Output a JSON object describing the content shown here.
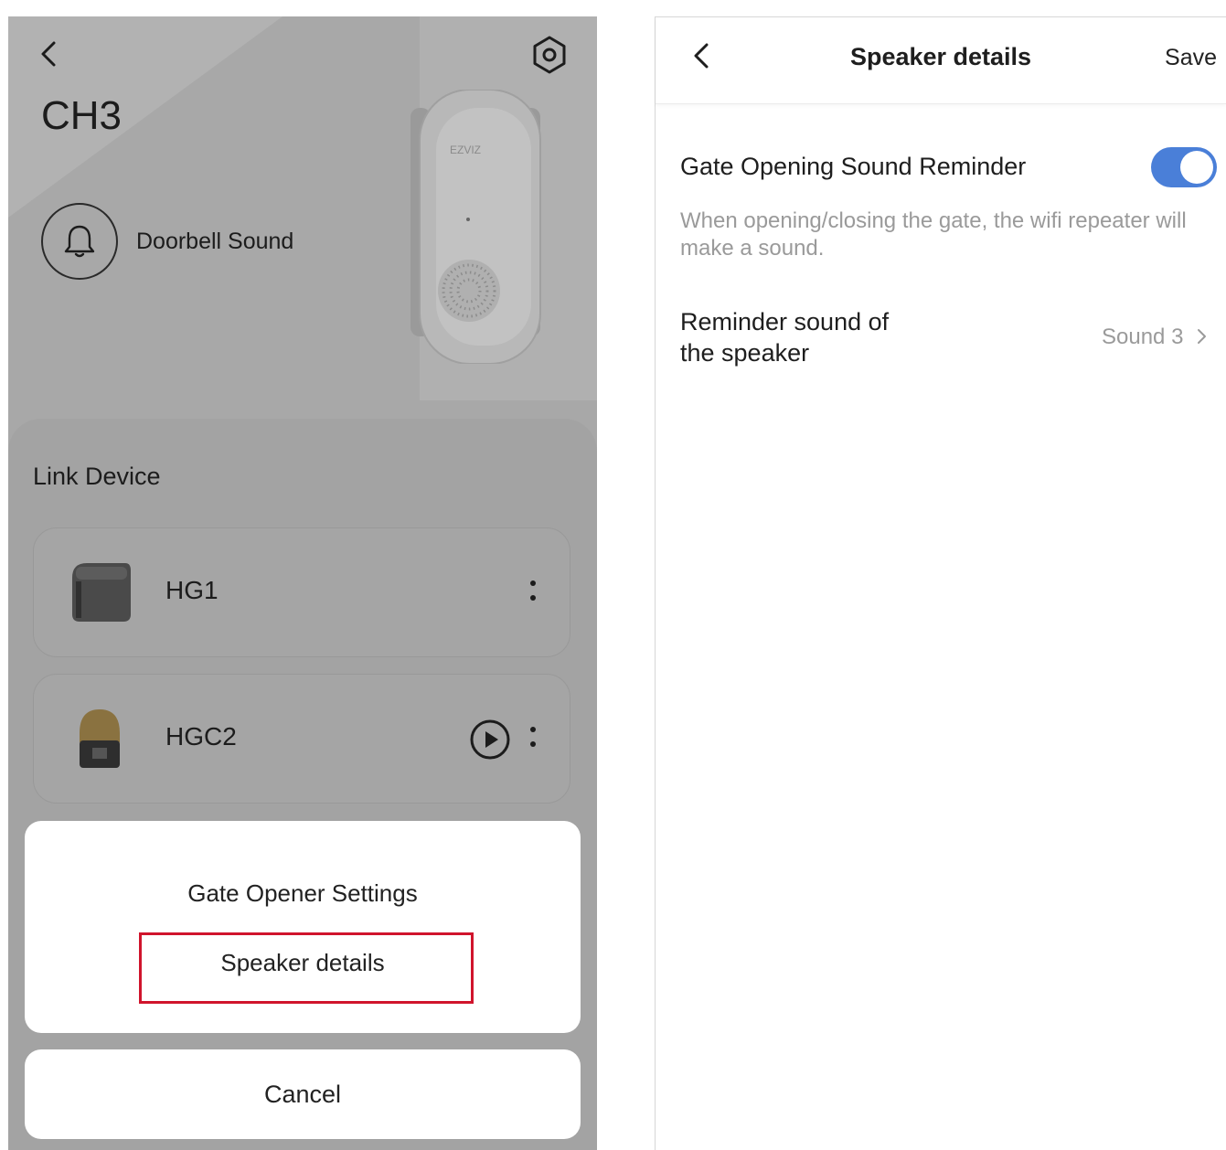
{
  "left": {
    "device_title": "CH3",
    "doorbell_label": "Doorbell Sound",
    "link_title": "Link Device",
    "devices": [
      {
        "name": "HG1"
      },
      {
        "name": "HGC2"
      }
    ],
    "sheet": {
      "option1": "Gate Opener Settings",
      "option2": "Speaker details",
      "cancel": "Cancel"
    },
    "brand_text": "EZVIZ"
  },
  "right": {
    "title": "Speaker details",
    "save": "Save",
    "toggle_label": "Gate Opening Sound Reminder",
    "toggle_on": true,
    "toggle_color": "#4a7fd8",
    "description": "When opening/closing the gate, the wifi repeater will make a sound.",
    "reminder_label": "Reminder sound of the speaker",
    "reminder_value": "Sound 3"
  },
  "colors": {
    "highlight": "#d0142c",
    "overlay": "#a8a8a8"
  }
}
